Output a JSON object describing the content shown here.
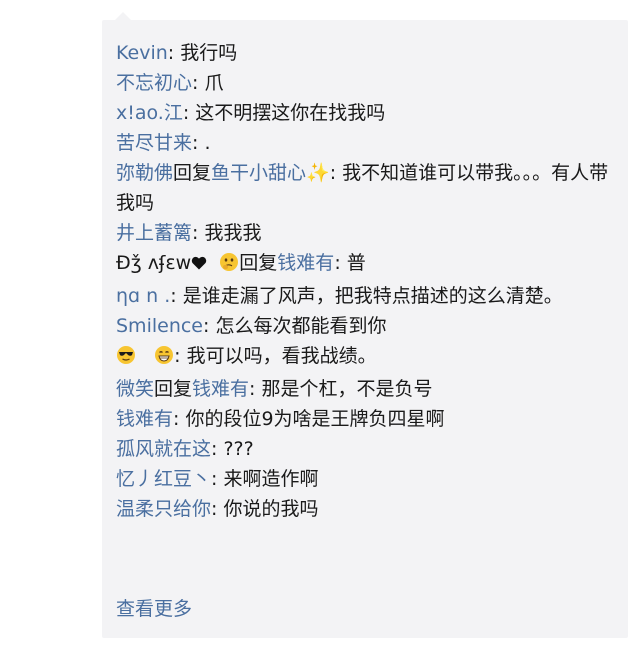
{
  "comments": [
    {
      "user": "Kevin",
      "text": "我行吗"
    },
    {
      "user": "不忘初心",
      "text": "爪"
    },
    {
      "user": "x!ao.江",
      "text": "这不明摆这你在找我吗"
    },
    {
      "user": "苦尽甘来",
      "text": "."
    },
    {
      "user": "弥勒佛",
      "reply_word": "回复",
      "reply_to": "鱼干小甜心",
      "text": "我不知道谁可以带我。。。有人带我吗"
    },
    {
      "user": "井上蓄篱",
      "text": "我我我"
    },
    {
      "user": "Ɖǯ ʌʄɛw",
      "reply_word": "回复",
      "reply_to": "钱难有",
      "text": "普"
    },
    {
      "user": "ηɑ n .",
      "text": "是谁走漏了风声，把我特点描述的这么清楚。"
    },
    {
      "user": "Smilence",
      "text": "怎么每次都能看到你"
    },
    {
      "user": "",
      "text": "我可以吗，看我战绩。"
    },
    {
      "user": "微笑",
      "reply_word": "回复",
      "reply_to": "钱难有",
      "text": "那是个杠，不是负号"
    },
    {
      "user": "钱难有",
      "text": "你的段位9为啥是王牌负四星啊"
    },
    {
      "user": "孤风就在这",
      "text": "???"
    },
    {
      "user": "忆丿红豆丶",
      "text": "来啊造作啊"
    },
    {
      "user": "温柔只给你",
      "text": "你说的我吗"
    }
  ],
  "separator": ": ",
  "more_label": "查看更多",
  "colors": {
    "username": "#4a6fa0",
    "text": "#1a1a1a",
    "panel_bg": "#f3f3f5"
  },
  "icons": [
    "black-heart-icon",
    "thinking-face-icon",
    "sparkles-icon",
    "sunglasses-face-icon",
    "grinning-face-icon"
  ]
}
